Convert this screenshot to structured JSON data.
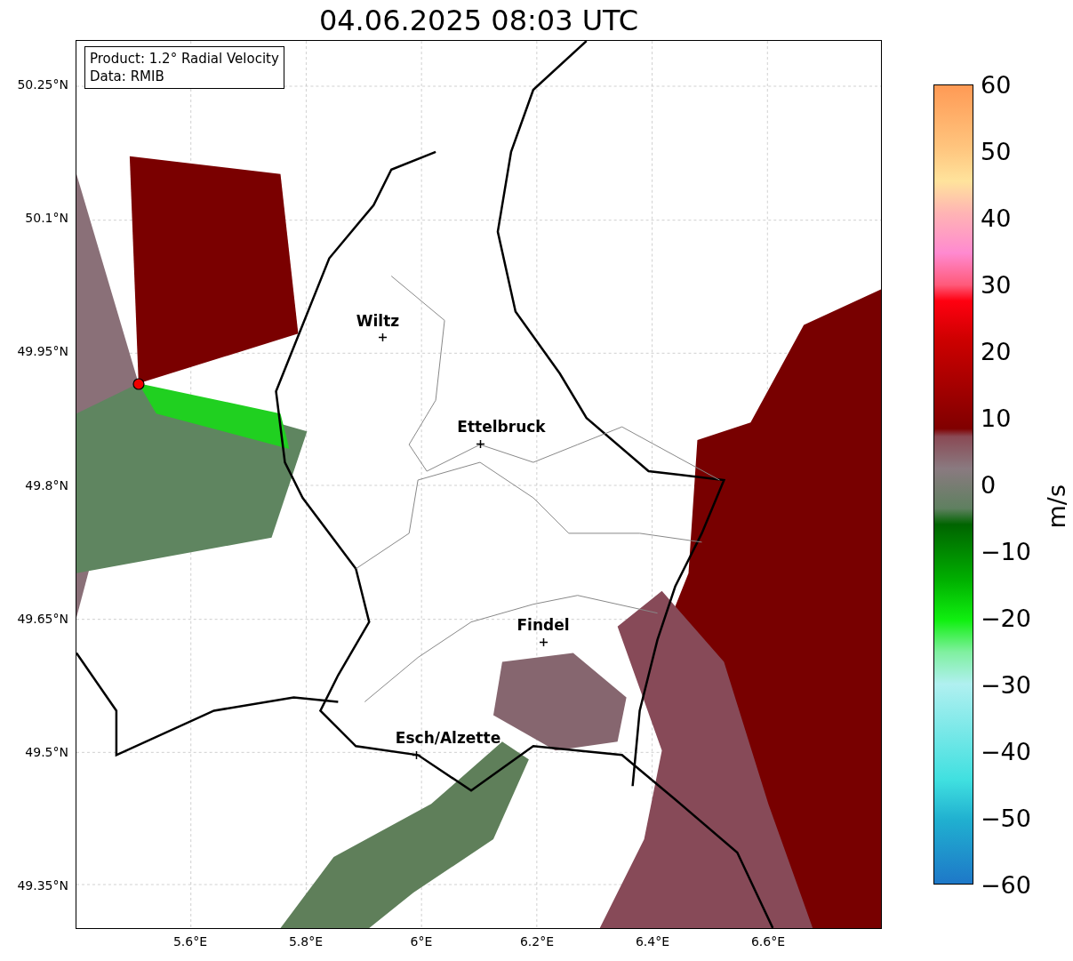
{
  "figure": {
    "title": "04.06.2025 08:03 UTC"
  },
  "map": {
    "info_box": [
      "Product: 1.2° Radial Velocity",
      "Data: RMIB"
    ],
    "yticks": [
      "50.25°N",
      "50.1°N",
      "49.95°N",
      "49.8°N",
      "49.65°N",
      "49.5°N",
      "49.35°N"
    ],
    "xticks": [
      "5.6°E",
      "5.8°E",
      "6°E",
      "6.2°E",
      "6.4°E",
      "6.6°E"
    ],
    "places": [
      {
        "name": "Wiltz"
      },
      {
        "name": "Ettelbruck"
      },
      {
        "name": "Findel"
      },
      {
        "name": "Esch/Alzette"
      }
    ]
  },
  "colorbar": {
    "label": "m/s",
    "ticks": [
      "60",
      "50",
      "40",
      "30",
      "20",
      "10",
      "0",
      "−10",
      "−20",
      "−30",
      "−40",
      "−50",
      "−60"
    ]
  }
}
